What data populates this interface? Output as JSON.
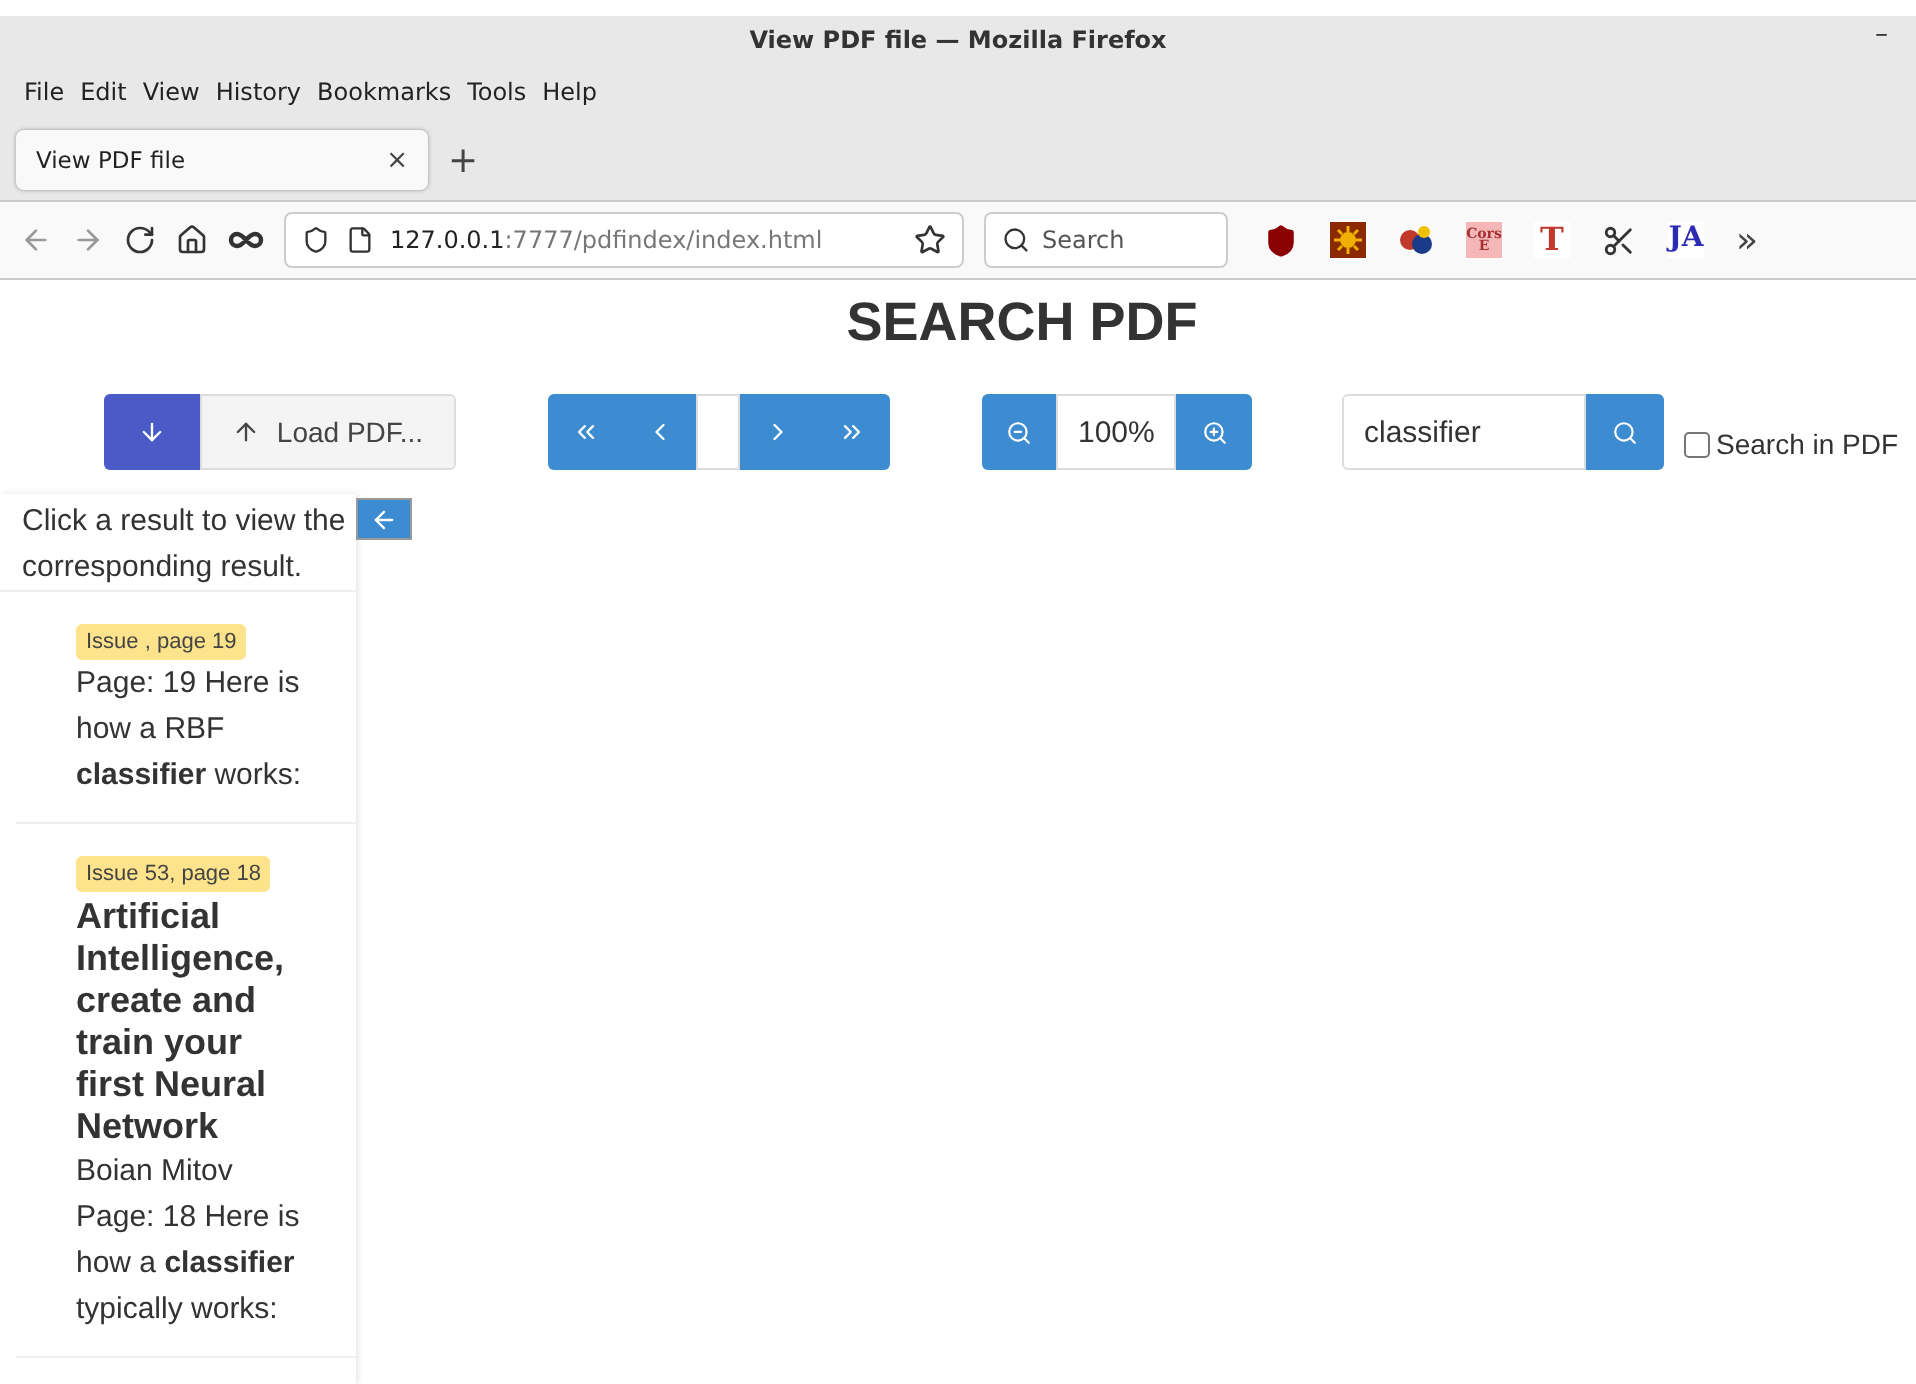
{
  "window": {
    "title": "View PDF file — Mozilla Firefox",
    "minimize": "–"
  },
  "menu": [
    "File",
    "Edit",
    "View",
    "History",
    "Bookmarks",
    "Tools",
    "Help"
  ],
  "tabs": [
    {
      "label": "View PDF file",
      "selected": true,
      "close": "×"
    }
  ],
  "new_tab": "+",
  "url": {
    "host": "127.0.0.1",
    "rest": ":7777/pdfindex/index.html"
  },
  "browser_search": {
    "placeholder": "Search"
  },
  "extensions": [
    {
      "kind": "shield"
    },
    {
      "kind": "sun"
    },
    {
      "kind": "balls"
    },
    {
      "kind": "cors",
      "label": "Cors E"
    },
    {
      "kind": "serif",
      "label": "T"
    },
    {
      "kind": "scissors"
    },
    {
      "kind": "script",
      "label": "JA"
    }
  ],
  "overflow": "»",
  "page": {
    "heading": "SEARCH PDF",
    "load_button": "Load PDF...",
    "zoom": "100%",
    "search": {
      "value": "classifier"
    },
    "search_in_pdf": {
      "label": "Search in PDF",
      "checked": false
    },
    "hint": "Click a result to view the corresponding result.",
    "results": [
      {
        "badge": "Issue , page 19",
        "text": "Page: 19 Here is how a RBF **classifier** works:"
      },
      {
        "badge": "Issue 53, page 18",
        "title": "Artificial Intelligence, create and train your first Neural Network",
        "author": "Boian Mitov",
        "text": "Page: 18 Here is how a **classifier** typically works:"
      }
    ]
  }
}
